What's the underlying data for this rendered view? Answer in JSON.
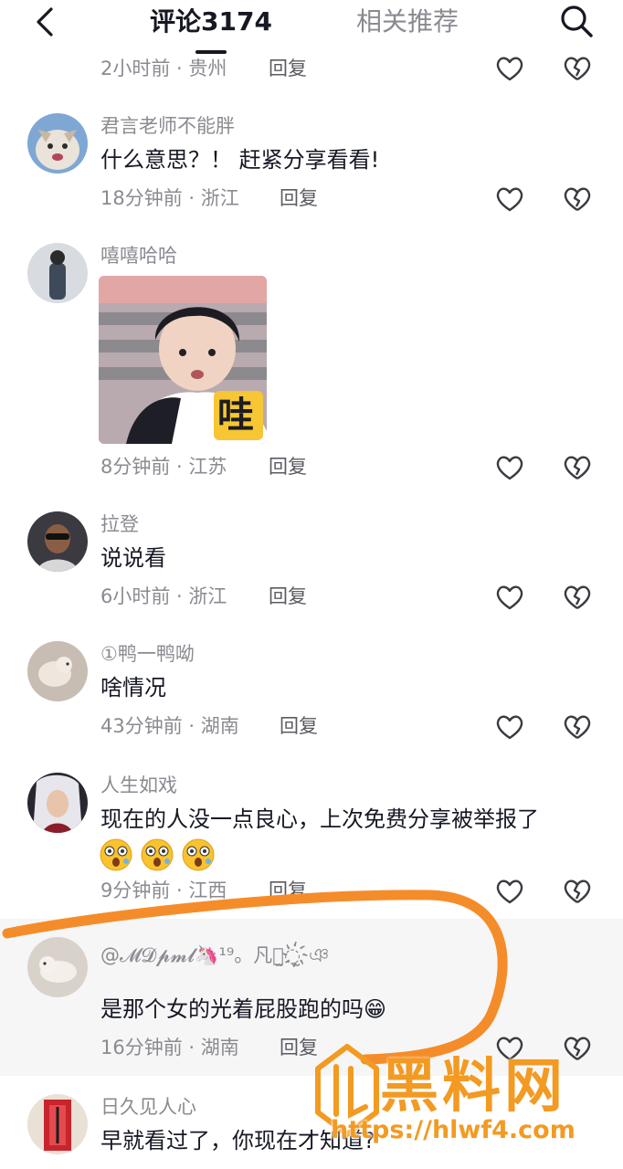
{
  "header": {
    "tab_comments": "评论3174",
    "tab_related": "相关推荐"
  },
  "comments": [
    {
      "meta": "2小时前 · 贵州",
      "reply": "回复"
    },
    {
      "username": "君言老师不能胖",
      "text": "什么意思？！ 赶紧分享看看!",
      "meta": "18分钟前 · 浙江",
      "reply": "回复"
    },
    {
      "username": "嘻嘻哈哈",
      "sticker_text": "哇",
      "meta": "8分钟前 · 江苏",
      "reply": "回复"
    },
    {
      "username": "拉登",
      "text": "说说看",
      "meta": "6小时前 · 浙江",
      "reply": "回复"
    },
    {
      "username": "①鸭一鸭呦",
      "text": "啥情况",
      "meta": "43分钟前 · 湖南",
      "reply": "回复"
    },
    {
      "username": "人生如戏",
      "text": "现在的人没一点良心，上次免费分享被举报了",
      "meta": "9分钟前 · 江西",
      "reply": "回复"
    },
    {
      "username": "@𝓜𝓓𝓹𝓶𝓵🦄¹⁹。凡︶̫◌̫҉ঞ",
      "text": "是那个女的光着屁股跑的吗😁",
      "meta": "16分钟前 · 湖南",
      "reply": "回复"
    },
    {
      "username": "日久见人心",
      "text": "早就看过了，你现在才知道?"
    }
  ],
  "watermark": {
    "text": "黑料网",
    "url": "https://hlwf4.com"
  },
  "colors": {
    "annotation": "#f58c2a",
    "watermark": "#f39a22"
  }
}
